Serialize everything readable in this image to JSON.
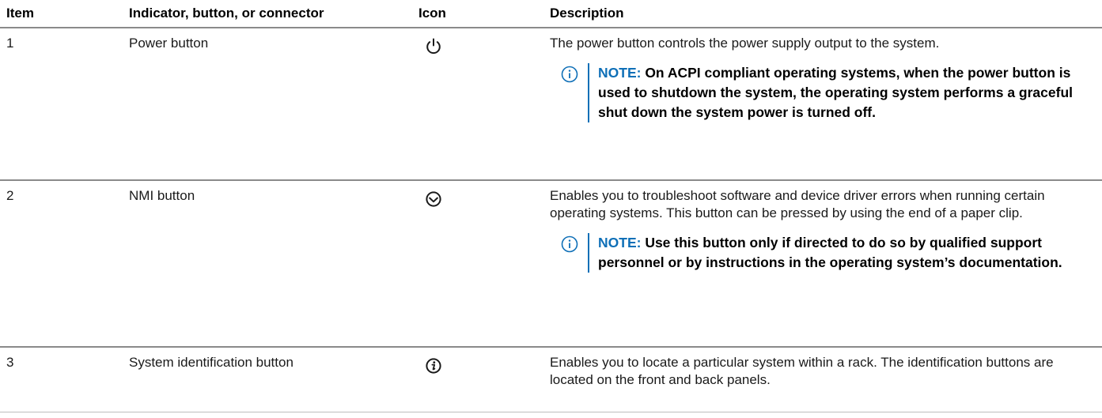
{
  "headers": {
    "item": "Item",
    "indicator": "Indicator, button, or connector",
    "icon": "Icon",
    "description": "Description"
  },
  "rows": [
    {
      "item": "1",
      "indicator": "Power button",
      "icon": "power-icon",
      "description": "The power button controls the power supply output to the system.",
      "note_label": "NOTE:",
      "note_text": " On ACPI compliant operating systems, when the power button is used to shutdown the system, the operating system performs a graceful shut down the system power is turned off."
    },
    {
      "item": "2",
      "indicator": "NMI button",
      "icon": "nmi-icon",
      "description": "Enables you to troubleshoot software and device driver errors when running certain operating systems. This button can be pressed by using the end of a paper clip.",
      "note_label": "NOTE:",
      "note_text": " Use this button only if directed to do so by qualified support personnel or by instructions in the operating system’s documentation."
    },
    {
      "item": "3",
      "indicator": "System identification button",
      "icon": "system-id-icon",
      "description": "Enables you to locate a particular system within a rack. The identification buttons are located on the front and back panels."
    }
  ],
  "colors": {
    "note_accent": "#0e6fb7",
    "rule": "#8a8a8a"
  }
}
